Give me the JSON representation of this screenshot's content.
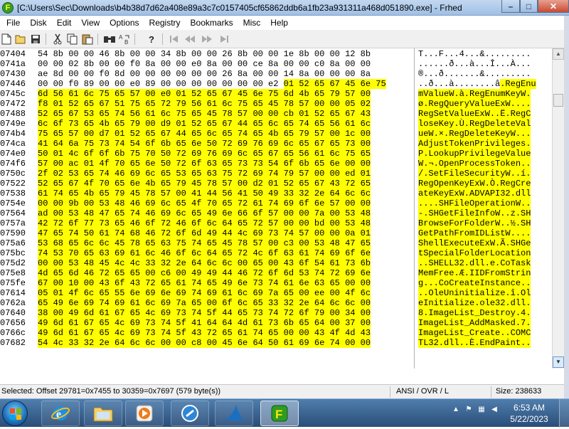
{
  "window": {
    "icon_letter": "F",
    "title": "[C:\\Users\\Sec\\Downloads\\b4b38d7d62a408e89a3c7c0157405cf65862ddb6a1fb23a931311a468d051890.exe] - Frhed",
    "minimize": "–",
    "maximize": "□",
    "close": "✕"
  },
  "menu": [
    "File",
    "Disk",
    "Edit",
    "View",
    "Options",
    "Registry",
    "Bookmarks",
    "Misc",
    "Help"
  ],
  "toolbar": [
    "new-icon",
    "open-icon",
    "save-icon",
    "cut-icon",
    "copy-icon",
    "paste-icon",
    "find-icon",
    "replace-icon",
    "help-icon",
    "first-icon",
    "prev-icon",
    "next-icon",
    "last-icon"
  ],
  "hex_rows": [
    {
      "offset": "07404",
      "hex": "54 8b 00 00 46 8b 00 00 34 8b 00 00 26 8b 00 00 1e 8b 00 00 12 8b",
      "ascii": "T...F...4...&........."
    },
    {
      "offset": "0741a",
      "hex": "00 00 02 8b 00 00 f0 8a 00 00 e0 8a 00 00 ce 8a 00 00 c0 8a 00 00",
      "ascii": "......ð...à...Î...À..."
    },
    {
      "offset": "07430",
      "hex": "ae 8d 00 00 f0 8d 00 00 00 00 00 00 26 8a 00 00 14 8a 00 00 00 8a",
      "ascii": "®...ð.......&........."
    },
    {
      "offset": "07446",
      "hex": "00 00 f0 89 00 00 e0 89 00 00 00 00 00 00 00 e2 01 52 65 67 45 6e 75",
      "ascii": "..ð...à........â.RegEnu"
    },
    {
      "offset": "0745c",
      "hex": "6d 56 61 6c 75 65 57 00 e0 01 52 65 67 45 6e 75 6d 4b 65 79 57 00",
      "ascii": "mValueW.à.RegEnumKeyW."
    },
    {
      "offset": "07472",
      "hex": "f8 01 52 65 67 51 75 65 72 79 56 61 6c 75 65 45 78 57 00 00 05 02",
      "ascii": "ø.RegQueryValueExW...."
    },
    {
      "offset": "07488",
      "hex": "52 65 67 53 65 74 56 61 6c 75 65 45 78 57 00 00 cb 01 52 65 67 43",
      "ascii": "RegSetValueExW..Ë.RegC"
    },
    {
      "offset": "0749e",
      "hex": "6c 6f 73 65 4b 65 79 00 d9 01 52 65 67 44 65 6c 65 74 65 56 61 6c",
      "ascii": "loseKey.Ù.RegDeleteVal"
    },
    {
      "offset": "074b4",
      "hex": "75 65 57 00 d7 01 52 65 67 44 65 6c 65 74 65 4b 65 79 57 00 1c 00",
      "ascii": "ueW.×.RegDeleteKeyW..."
    },
    {
      "offset": "074ca",
      "hex": "41 64 6a 75 73 74 54 6f 6b 65 6e 50 72 69 76 69 6c 65 67 65 73 00",
      "ascii": "AdjustTokenPrivileges."
    },
    {
      "offset": "074e0",
      "hex": "50 01 4c 6f 6f 6b 75 70 50 72 69 76 69 6c 65 67 65 56 61 6c 75 65",
      "ascii": "P.LookupPrivilegeValue"
    },
    {
      "offset": "074f6",
      "hex": "57 00 ac 01 4f 70 65 6e 50 72 6f 63 65 73 73 54 6f 6b 65 6e 00 00",
      "ascii": "W.¬.OpenProcessToken.."
    },
    {
      "offset": "0750c",
      "hex": "2f 02 53 65 74 46 69 6c 65 53 65 63 75 72 69 74 79 57 00 00 ed 01",
      "ascii": "/.SetFileSecurityW..í."
    },
    {
      "offset": "07522",
      "hex": "52 65 67 4f 70 65 6e 4b 65 79 45 78 57 00 d2 01 52 65 67 43 72 65",
      "ascii": "RegOpenKeyExW.Ò.RegCre"
    },
    {
      "offset": "07538",
      "hex": "61 74 65 4b 65 79 45 78 57 00 41 44 56 41 50 49 33 32 2e 64 6c 6c",
      "ascii": "ateKeyExW.ADVAPI32.dll"
    },
    {
      "offset": "0754e",
      "hex": "00 00 9b 00 53 48 46 69 6c 65 4f 70 65 72 61 74 69 6f 6e 57 00 00",
      "ascii": "....SHFileOperationW.."
    },
    {
      "offset": "07564",
      "hex": "ad 00 53 48 47 65 74 46 69 6c 65 49 6e 66 6f 57 00 00 7a 00 53 48",
      "ascii": "-.SHGetFileInfoW..z.SH"
    },
    {
      "offset": "0757a",
      "hex": "42 72 6f 77 73 65 46 6f 72 46 6f 6c 64 65 72 57 00 00 bd 00 53 48",
      "ascii": "BrowseForFolderW..½.SH"
    },
    {
      "offset": "07590",
      "hex": "47 65 74 50 61 74 68 46 72 6f 6d 49 44 4c 69 73 74 57 00 00 0a 01",
      "ascii": "GetPathFromIDListW...."
    },
    {
      "offset": "075a6",
      "hex": "53 68 65 6c 6c 45 78 65 63 75 74 65 45 78 57 00 c3 00 53 48 47 65",
      "ascii": "ShellExecuteExW.Ã.SHGe"
    },
    {
      "offset": "075bc",
      "hex": "74 53 70 65 63 69 61 6c 46 6f 6c 64 65 72 4c 6f 63 61 74 69 6f 6e",
      "ascii": "tSpecialFolderLocation"
    },
    {
      "offset": "075d2",
      "hex": "00 00 53 48 45 4c 4c 33 32 2e 64 6c 6c 00 65 00 43 6f 54 61 73 6b",
      "ascii": "..SHELL32.dll.e.CoTask"
    },
    {
      "offset": "075e8",
      "hex": "4d 65 6d 46 72 65 65 00 c6 00 49 49 44 46 72 6f 6d 53 74 72 69 6e",
      "ascii": "MemFree.Æ.IIDFromStrin"
    },
    {
      "offset": "075fe",
      "hex": "67 00 10 00 43 6f 43 72 65 61 74 65 49 6e 73 74 61 6e 63 65 00 00",
      "ascii": "g...CoCreateInstance.."
    },
    {
      "offset": "07614",
      "hex": "05 01 4f 6c 65 55 6e 69 6e 69 74 69 61 6c 69 7a 65 00 ee 00 4f 6c",
      "ascii": "..OleUninitialize.î.Ol"
    },
    {
      "offset": "0762a",
      "hex": "65 49 6e 69 74 69 61 6c 69 7a 65 00 6f 6c 65 33 32 2e 64 6c 6c 00",
      "ascii": "eInitialize.ole32.dll."
    },
    {
      "offset": "07640",
      "hex": "38 00 49 6d 61 67 65 4c 69 73 74 5f 44 65 73 74 72 6f 79 00 34 00",
      "ascii": "8.ImageList_Destroy.4."
    },
    {
      "offset": "07656",
      "hex": "49 6d 61 67 65 4c 69 73 74 5f 41 64 64 4d 61 73 6b 65 64 00 37 00",
      "ascii": "ImageList_AddMasked.7."
    },
    {
      "offset": "0766c",
      "hex": "49 6d 61 67 65 4c 69 73 74 5f 43 72 65 61 74 65 00 00 43 4f 4d 43",
      "ascii": "ImageList_Create..COMC"
    },
    {
      "offset": "07682",
      "hex": "54 4c 33 32 2e 64 6c 6c 00 00 c8 00 45 6e 64 50 61 69 6e 74 00 00",
      "ascii": "TL32.dll..È.EndPaint.."
    }
  ],
  "status": {
    "selection": "Selected: Offset 29781=0x7455 to 30359=0x7697 (579 byte(s))",
    "mode": "ANSI / OVR / L",
    "size": "Size: 238633"
  },
  "taskbar": {
    "apps": [
      "internet-explorer-icon",
      "file-explorer-icon",
      "media-player-icon",
      "app-icon-circle",
      "wireshark-icon",
      "frhed-icon"
    ],
    "time": "6:53 AM",
    "date": "5/22/2023"
  }
}
